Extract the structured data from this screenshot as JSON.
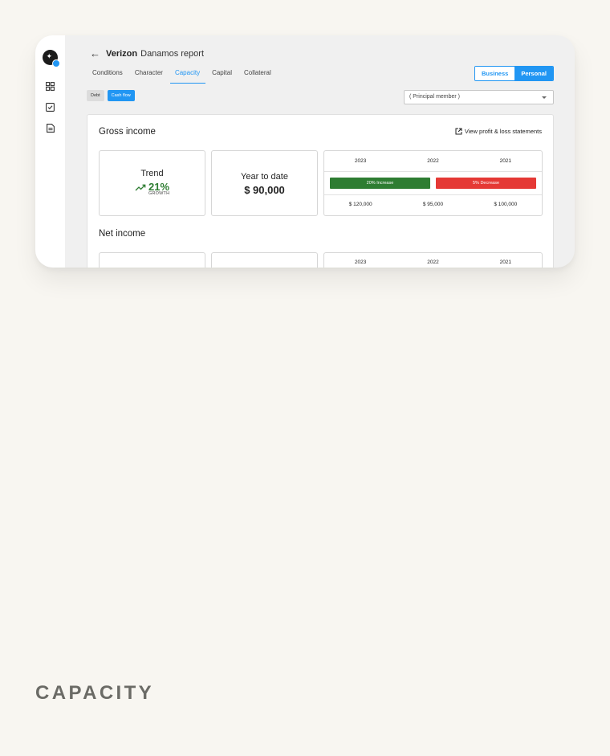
{
  "app": {
    "title_company": "Verizon",
    "title_rest": "Danamos report"
  },
  "tabs": [
    {
      "label": "Conditions"
    },
    {
      "label": "Character"
    },
    {
      "label": "Capacity"
    },
    {
      "label": "Capital"
    },
    {
      "label": "Collateral"
    }
  ],
  "active_tab": "Capacity",
  "segment": {
    "business": "Business",
    "personal": "Personal",
    "selected": "Personal"
  },
  "chips": {
    "debt": "Debt",
    "cash_flow": "Cash flow",
    "selected": "Cash flow"
  },
  "member_select": {
    "value": "( Principal member )"
  },
  "gross_income": {
    "title": "Gross income",
    "view_link": "View profit & loss statements",
    "trend_label": "Trend",
    "trend_value": "21%",
    "trend_sub": "GROWTH",
    "ytd_label": "Year to date",
    "ytd_value": "$ 90,000",
    "years": [
      "2023",
      "2022",
      "2021"
    ],
    "changes": [
      "20% Increase",
      "5% Decrease"
    ],
    "amounts": [
      "$ 120,000",
      "$ 95,000",
      "$ 100,000"
    ]
  },
  "net_income": {
    "title": "Net income",
    "years": [
      "2023",
      "2022",
      "2021"
    ]
  },
  "caption": "CAPACITY",
  "colors": {
    "accent": "#2196f3",
    "increase": "#2e7d32",
    "decrease": "#e53935",
    "background": "#f8f6f1"
  },
  "icons": {
    "back": "arrow-left-icon",
    "dashboard": "grid-icon",
    "tasks": "checkbox-icon",
    "documents": "document-icon",
    "external": "open-external-icon",
    "trend": "trending-up-icon"
  }
}
